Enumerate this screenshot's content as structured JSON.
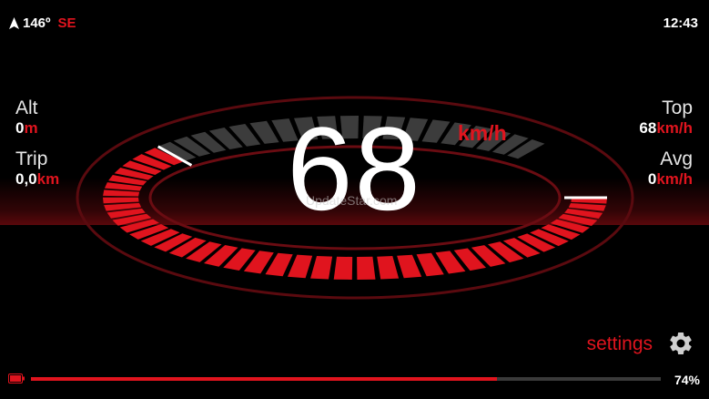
{
  "status": {
    "heading_degrees": "146º",
    "heading_direction": "SE",
    "clock": "12:43"
  },
  "left_stats": [
    {
      "label": "Alt",
      "value": "0",
      "unit": "m"
    },
    {
      "label": "Trip",
      "value": "0,0",
      "unit": "km"
    }
  ],
  "right_stats": [
    {
      "label": "Top",
      "value": "68",
      "unit": "km/h"
    },
    {
      "label": "Avg",
      "value": "0",
      "unit": "km/h"
    }
  ],
  "speedometer": {
    "speed": "68",
    "unit": "km/h",
    "level_fraction": 0.68,
    "watermark": "UpdateStar.com"
  },
  "settings_label": "settings",
  "battery": {
    "percent_label": "74%",
    "level": 0.74
  },
  "colors": {
    "accent": "#e0141e",
    "background": "#000000",
    "inactive_tick": "#3c3c3c"
  },
  "icons": {
    "compass": "navigation-arrow-icon",
    "settings": "gear-icon",
    "battery": "battery-icon"
  }
}
